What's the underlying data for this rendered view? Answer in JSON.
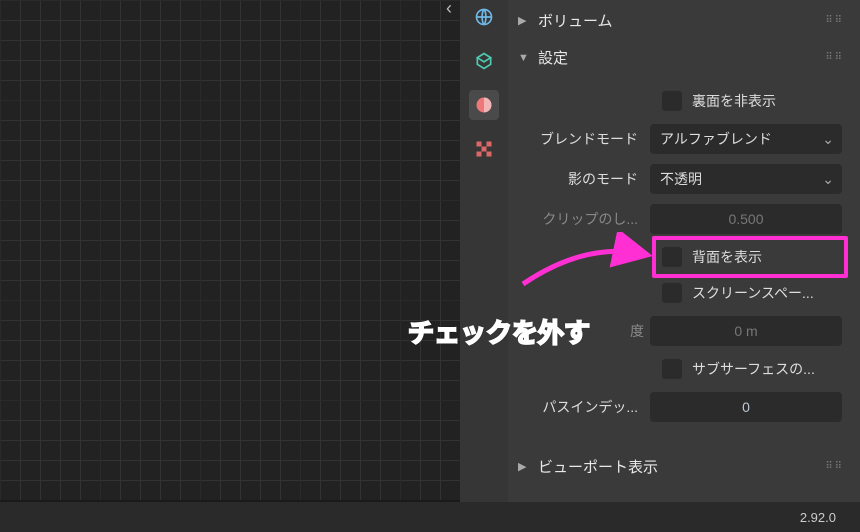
{
  "sections": {
    "volume": {
      "title": "ボリューム"
    },
    "settings": {
      "title": "設定"
    },
    "viewport_display": {
      "title": "ビューポート表示"
    }
  },
  "settings_panel": {
    "backface_culling": {
      "label": "裏面を非表示"
    },
    "blend_mode": {
      "label": "ブレンドモード",
      "value": "アルファブレンド"
    },
    "shadow_mode": {
      "label": "影のモード",
      "value": "不透明"
    },
    "clip_threshold": {
      "label": "クリップのし...",
      "value": "0.500"
    },
    "show_backface": {
      "label": "背面を表示"
    },
    "screen_space": {
      "label": "スクリーンスペー..."
    },
    "thickness": {
      "label_tail": "度",
      "value": "0 m"
    },
    "subsurface": {
      "label": "サブサーフェスの..."
    },
    "pass_index": {
      "label": "パスインデッ...",
      "value": "0"
    }
  },
  "annotation": {
    "text": "チェックを外す"
  },
  "status": {
    "version": "2.92.0"
  },
  "icons": {
    "globe": "globe-icon",
    "tree": "object-data-icon",
    "material": "material-icon",
    "texture": "texture-icon"
  }
}
